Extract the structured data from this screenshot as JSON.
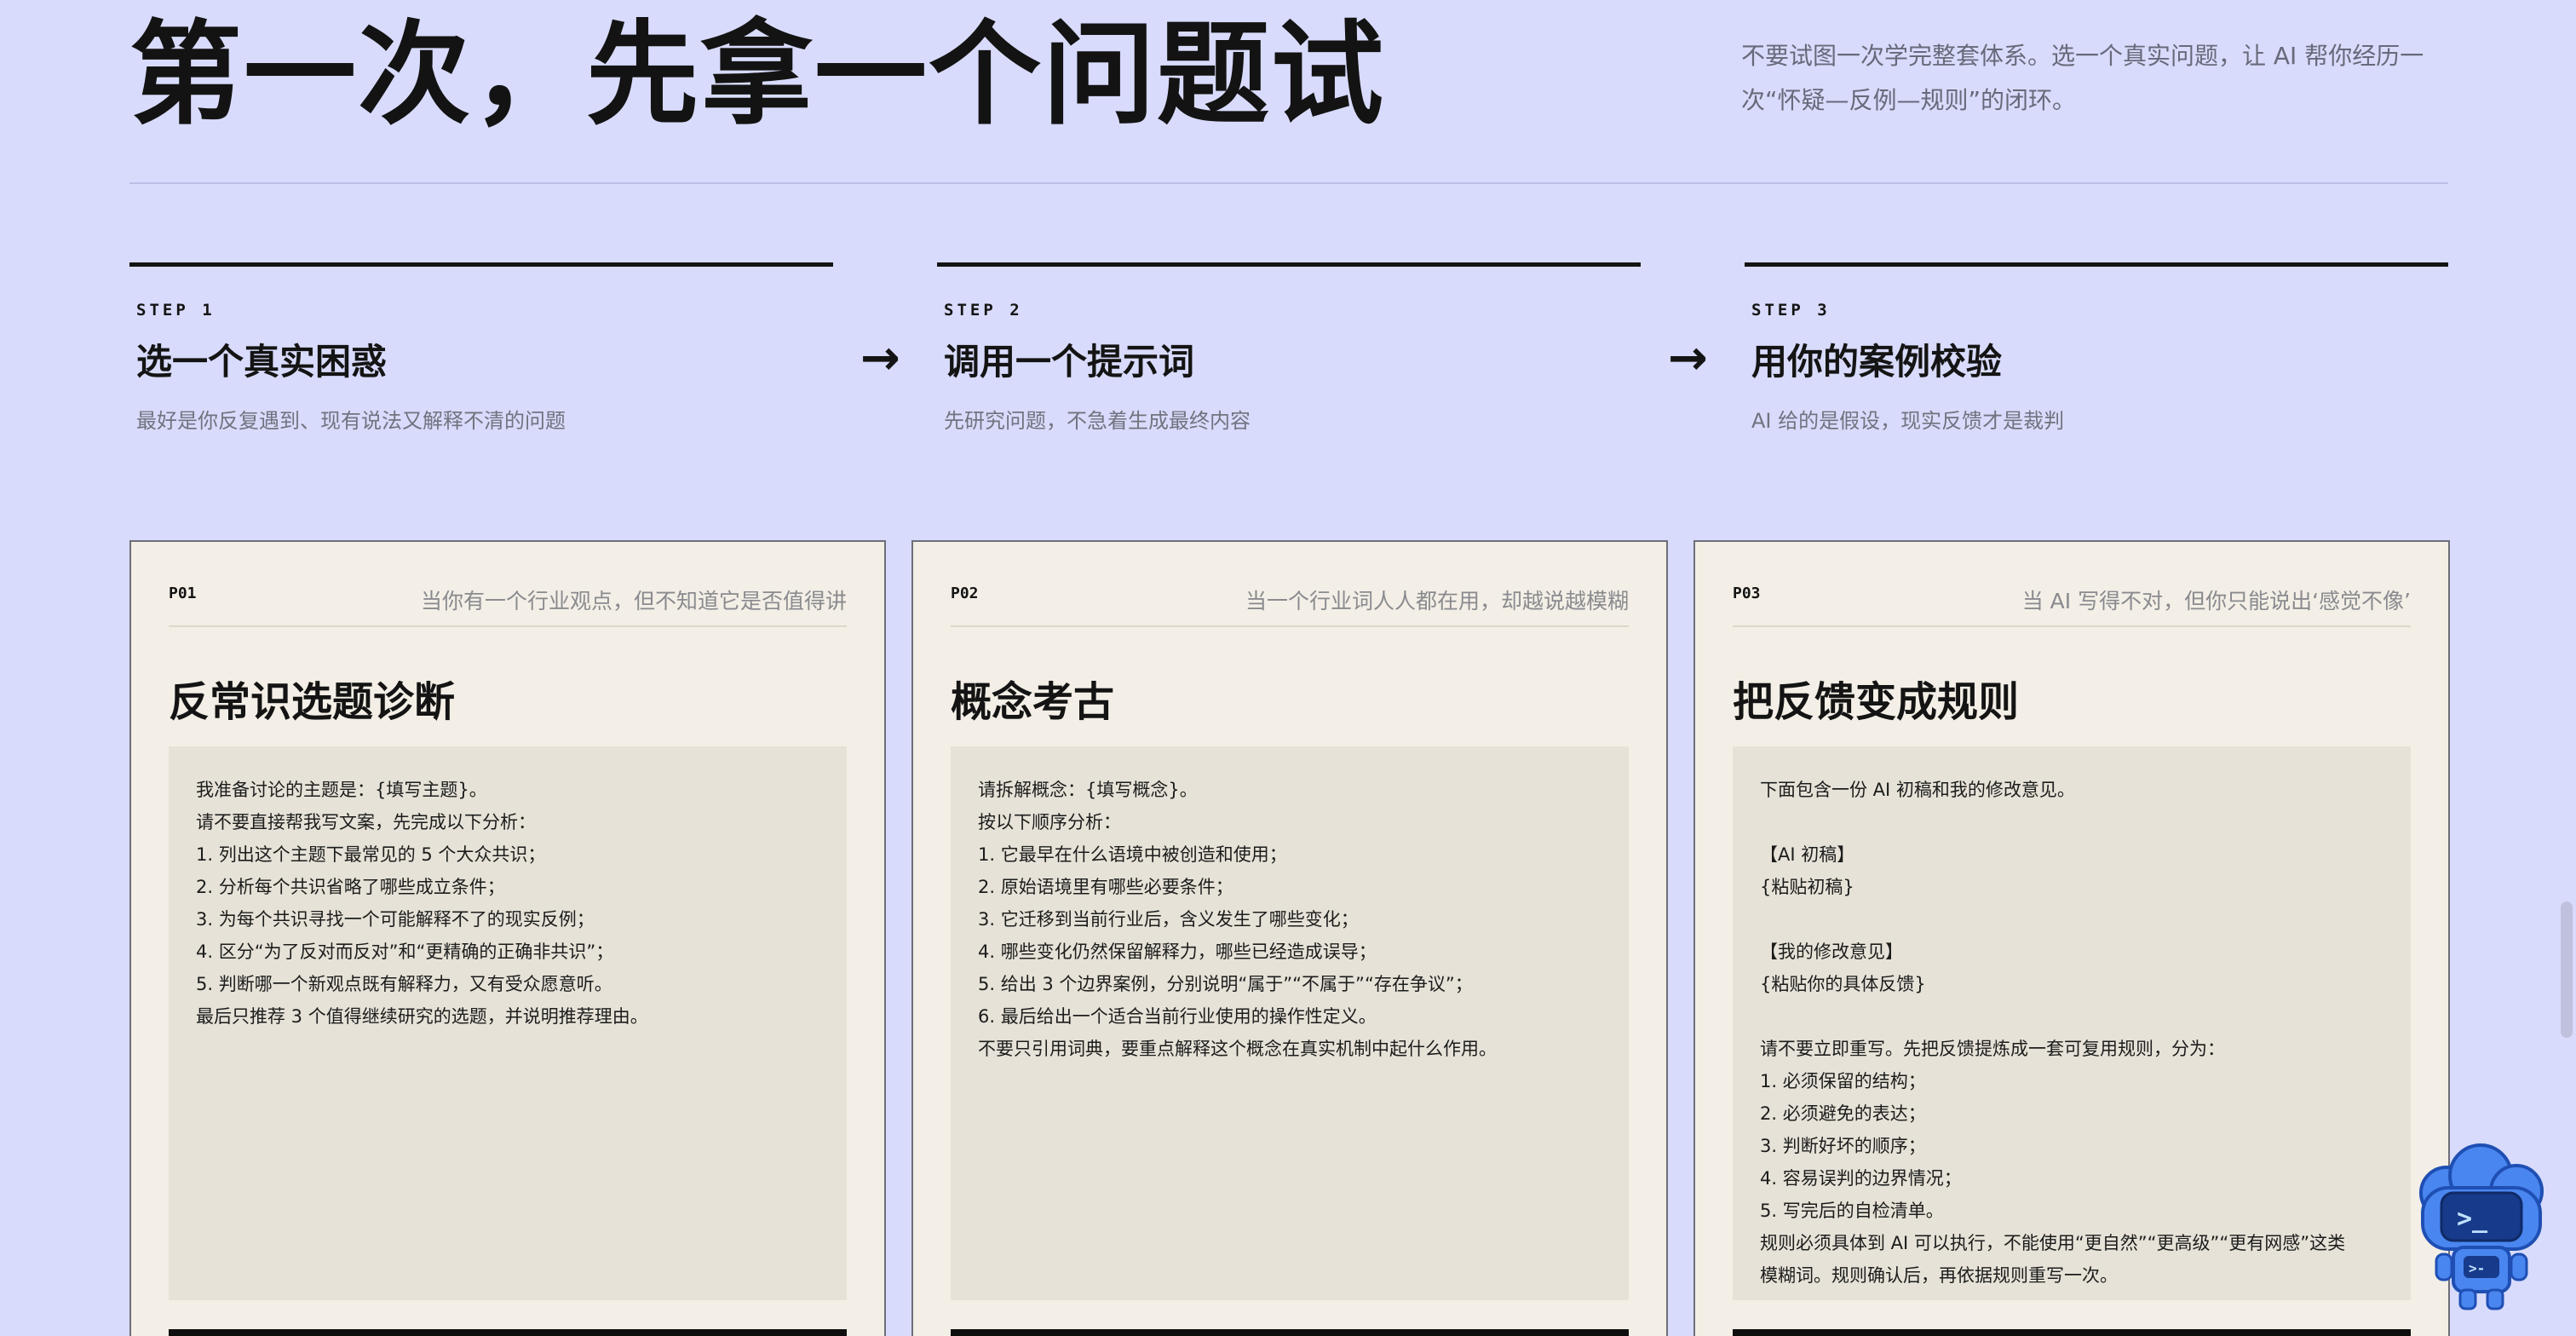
{
  "hero": {
    "title": "第一次，先拿一个问题试",
    "description": "不要试图一次学完整套体系。选一个真实问题，让 AI 帮你经历一次“怀疑—反例—规则”的闭环。"
  },
  "steps": [
    {
      "label": "STEP 1",
      "title": "选一个真实困惑",
      "sub": "最好是你反复遇到、现有说法又解释不清的问题"
    },
    {
      "label": "STEP 2",
      "title": "调用一个提示词",
      "sub": "先研究问题，不急着生成最终内容"
    },
    {
      "label": "STEP 3",
      "title": "用你的案例校验",
      "sub": "AI 给的是假设，现实反馈才是裁判"
    }
  ],
  "arrow": "→",
  "cards": [
    {
      "id": "P01",
      "hint": "当你有一个行业观点，但不知道它是否值得讲",
      "title": "反常识选题诊断",
      "lines": [
        "我准备讨论的主题是：{填写主题}。",
        "请不要直接帮我写文案，先完成以下分析：",
        "1. 列出这个主题下最常见的 5 个大众共识；",
        "2. 分析每个共识省略了哪些成立条件；",
        "3. 为每个共识寻找一个可能解释不了的现实反例；",
        "4. 区分“为了反对而反对”和“更精确的正确非共识”；",
        "5. 判断哪一个新观点既有解释力，又有受众愿意听。",
        "最后只推荐 3 个值得继续研究的选题，并说明推荐理由。"
      ]
    },
    {
      "id": "P02",
      "hint": "当一个行业词人人都在用，却越说越模糊",
      "title": "概念考古",
      "lines": [
        "请拆解概念：{填写概念}。",
        "按以下顺序分析：",
        "1. 它最早在什么语境中被创造和使用；",
        "2. 原始语境里有哪些必要条件；",
        "3. 它迁移到当前行业后，含义发生了哪些变化；",
        "4. 哪些变化仍然保留解释力，哪些已经造成误导；",
        "5. 给出 3 个边界案例，分别说明“属于”“不属于”“存在争议”；",
        "6. 最后给出一个适合当前行业使用的操作性定义。",
        "不要只引用词典，要重点解释这个概念在真实机制中起什么作用。"
      ]
    },
    {
      "id": "P03",
      "hint": "当 AI 写得不对，但你只能说出‘感觉不像’",
      "title": "把反馈变成规则",
      "lines": [
        "下面包含一份 AI 初稿和我的修改意见。",
        "",
        "【AI 初稿】",
        "{粘贴初稿}",
        "",
        "【我的修改意见】",
        "{粘贴你的具体反馈}",
        "",
        "请不要立即重写。先把反馈提炼成一套可复用规则，分为：",
        "1. 必须保留的结构；",
        "2. 必须避免的表达；",
        "3. 判断好坏的顺序；",
        "4. 容易误判的边界情况；",
        "5. 写完后的自检清单。",
        "规则必须具体到 AI 可以执行，不能使用“更自然”“更高级”“更有网感”这类",
        "模糊词。规则确认后，再依据规则重写一次。"
      ]
    }
  ],
  "mascot": {
    "icon": "robot-terminal-icon",
    "face_text": ">_"
  },
  "colors": {
    "background": "#d8dbfb",
    "card": "#f3efe6",
    "prompt_box": "#e6e2d7",
    "accent_ink": "#141414",
    "mascot_blue": "#4a86f0"
  }
}
